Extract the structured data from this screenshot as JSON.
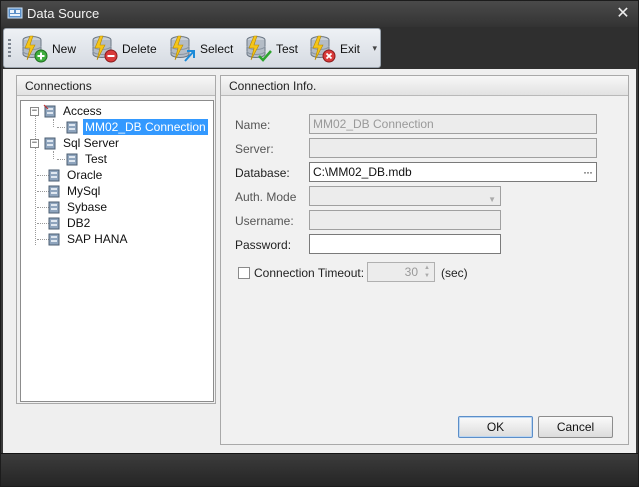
{
  "window": {
    "title": "Data Source",
    "close_glyph": "✕"
  },
  "toolbar": {
    "buttons": [
      {
        "label": "New",
        "icon": "db-add-icon"
      },
      {
        "label": "Delete",
        "icon": "db-delete-icon"
      },
      {
        "label": "Select",
        "icon": "db-select-icon"
      },
      {
        "label": "Test",
        "icon": "db-test-icon"
      },
      {
        "label": "Exit",
        "icon": "db-exit-icon"
      }
    ],
    "overflow_glyph": "▾"
  },
  "connections": {
    "header": "Connections",
    "tree": [
      {
        "label": "Access",
        "expander": "−",
        "children": [
          {
            "label": "MM02_DB Connection",
            "selected": true
          }
        ]
      },
      {
        "label": "Sql Server",
        "expander": "−",
        "children": [
          {
            "label": "Test"
          }
        ]
      },
      {
        "label": "Oracle"
      },
      {
        "label": "MySql"
      },
      {
        "label": "Sybase"
      },
      {
        "label": "DB2"
      },
      {
        "label": "SAP HANA"
      }
    ]
  },
  "info": {
    "header": "Connection Info.",
    "name": {
      "label": "Name:",
      "value": "MM02_DB Connection"
    },
    "server": {
      "label": "Server:",
      "value": ""
    },
    "database": {
      "label": "Database:",
      "value": "C:\\MM02_DB.mdb",
      "browse_glyph": "···"
    },
    "auth": {
      "label": "Auth. Mode",
      "value": ""
    },
    "username": {
      "label": "Username:",
      "value": ""
    },
    "password": {
      "label": "Password:",
      "value": ""
    },
    "timeout": {
      "label": "Connection Timeout:",
      "value": "30",
      "unit": "(sec)",
      "checked": false
    }
  },
  "buttons": {
    "ok": "OK",
    "cancel": "Cancel"
  },
  "colors": {
    "selection": "#3399ff",
    "titlebar": "#3a3a3a"
  }
}
